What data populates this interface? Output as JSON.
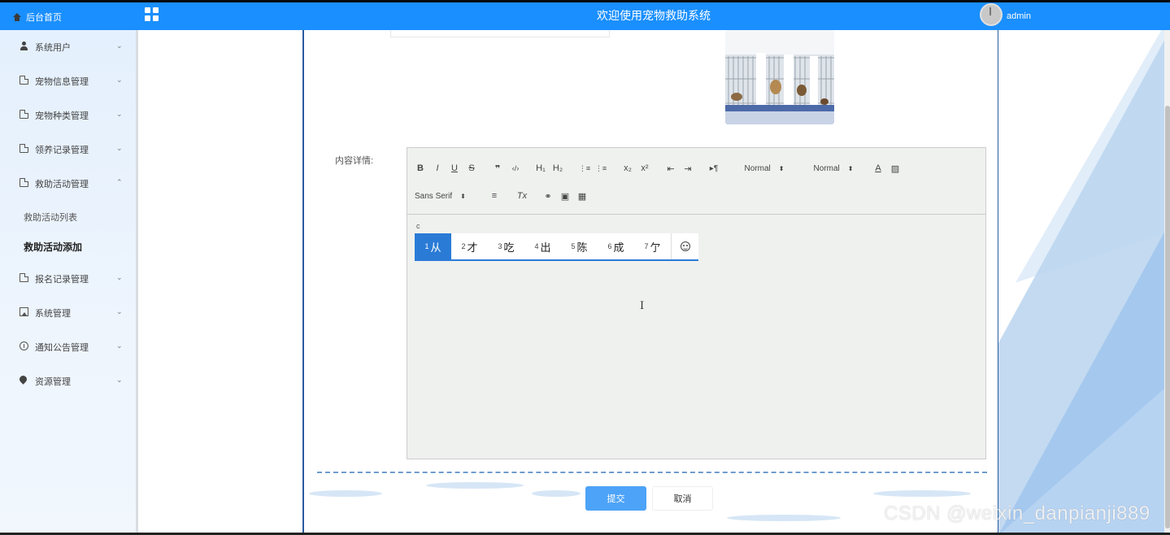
{
  "header": {
    "home_label": "后台首页",
    "title": "欢迎使用宠物救助系统",
    "username": "admin"
  },
  "sidebar": {
    "items": [
      {
        "label": "系统用户",
        "icon": "user-icon",
        "chevron": "⌄"
      },
      {
        "label": "宠物信息管理",
        "icon": "document-icon",
        "chevron": "⌄"
      },
      {
        "label": "宠物种类管理",
        "icon": "document-icon",
        "chevron": "⌄"
      },
      {
        "label": "领养记录管理",
        "icon": "document-icon",
        "chevron": "⌄"
      },
      {
        "label": "救助活动管理",
        "icon": "document-icon",
        "chevron": "⌃"
      },
      {
        "label": "报名记录管理",
        "icon": "document-icon",
        "chevron": "⌄"
      },
      {
        "label": "系统管理",
        "icon": "picture-icon",
        "chevron": "⌄"
      },
      {
        "label": "通知公告管理",
        "icon": "info-icon",
        "chevron": "⌄"
      },
      {
        "label": "资源管理",
        "icon": "drop-icon",
        "chevron": "⌄"
      }
    ],
    "sub_items": [
      {
        "label": "救助活动列表",
        "active": false
      },
      {
        "label": "救助活动添加",
        "active": true
      }
    ]
  },
  "form": {
    "content_label": "内容详情:",
    "editor": {
      "toolbar": {
        "bold": "B",
        "italic": "I",
        "underline": "U",
        "strike": "S",
        "blockquote": "❞",
        "code": "‹/›",
        "h1": "H₁",
        "h2": "H₂",
        "ordered_list": "⋮≡",
        "bullet_list": "⋮≡",
        "subscript": "x₂",
        "superscript": "x²",
        "outdent": "⇤",
        "indent": "⇥",
        "direction": "▸¶",
        "size_select": "Normal",
        "header_select": "Normal",
        "color": "A",
        "background": "▨",
        "font_select": "Sans Serif",
        "align": "≡",
        "clean": "Tx",
        "link": "⚭",
        "image": "▣",
        "video": "▦"
      },
      "ime": {
        "pinyin": "c",
        "candidates": [
          {
            "n": "1",
            "ch": "从",
            "selected": true
          },
          {
            "n": "2",
            "ch": "才",
            "selected": false
          },
          {
            "n": "3",
            "ch": "吃",
            "selected": false
          },
          {
            "n": "4",
            "ch": "出",
            "selected": false
          },
          {
            "n": "5",
            "ch": "陈",
            "selected": false
          },
          {
            "n": "6",
            "ch": "成",
            "selected": false
          },
          {
            "n": "7",
            "ch": "亇",
            "selected": false
          }
        ]
      },
      "text_cursor": "I"
    },
    "submit_label": "提交",
    "cancel_label": "取消"
  },
  "watermark": "CSDN @weixin_danpianji889",
  "colors": {
    "header_bg": "#1a8fff",
    "primary_button": "#4da3f8",
    "ime_selected": "#2a7bd6",
    "panel_border": "#2b5aa0"
  }
}
